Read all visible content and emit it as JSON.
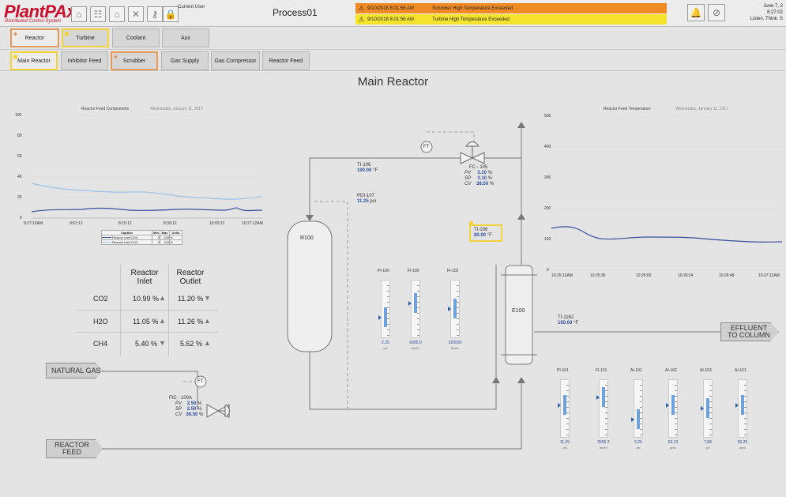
{
  "header": {
    "logo_main": "PlantPAx",
    "logo_sub": "Distributed Control System",
    "current_user_label": "Current User",
    "process_title": "Process01",
    "alarms": [
      {
        "timestamp": "9/10/2018 8:01:56 AM",
        "message": "Scrubber High Temperature Exceeded",
        "color": "#f08a24"
      },
      {
        "timestamp": "9/10/2018 8:01:56 AM",
        "message": "Turbine High Temperature Exceeded",
        "color": "#f5e32e"
      }
    ],
    "date": "June 7, 2",
    "time": "8:27:02",
    "tagline": "Listen. Think. S"
  },
  "nav_top": [
    "Reactor",
    "Turbine",
    "Coolant",
    "Aux"
  ],
  "nav_sub": [
    "Main Reactor",
    "Inhibitor Feed",
    "Scrubber",
    "Gas Supply",
    "Gas Compressor",
    "Reactor Feed"
  ],
  "page_title": "Main Reactor",
  "left_chart": {
    "title": "Reactor Feed Components",
    "date": "Wednesday, January 11, 2017",
    "y_ticks": [
      "100",
      "80",
      "60",
      "40",
      "20",
      "0"
    ],
    "x_ticks": [
      "9:27:12AM",
      "9:51:12",
      "",
      "8:15:12",
      "",
      "8:39:12",
      "",
      "10:03:12",
      "10:27:12AM"
    ],
    "legend_headers": [
      "Caption",
      "Min",
      "Max",
      "Units"
    ],
    "legend_rows": [
      [
        "Reactor Inlet CH4",
        "0",
        "100",
        "%"
      ],
      [
        "Reactor Inlet CO2",
        "0",
        "100",
        "%"
      ]
    ]
  },
  "right_chart": {
    "title": "Reactor Feed Temperature",
    "date": "Wednesday, January 11, 2017",
    "y_ticks": [
      "500",
      "400",
      "300",
      "200",
      "100",
      "0"
    ],
    "x_ticks": [
      "10:25:12AM",
      "10:25:36",
      "",
      "10:26:00",
      "",
      "10:26:24",
      "",
      "10:26:48",
      "",
      "10:27:12AM"
    ]
  },
  "composition": {
    "header_inlet": "Reactor Inlet",
    "header_outlet": "Reactor Outlet",
    "rows": [
      {
        "name": "CO2",
        "inlet": "10.99 %",
        "inlet_dir": "up",
        "outlet": "11.20 %",
        "outlet_dir": "down"
      },
      {
        "name": "H2O",
        "inlet": "11.05 %",
        "inlet_dir": "up",
        "outlet": "11.26 %",
        "outlet_dir": "up"
      },
      {
        "name": "CH4",
        "inlet": "5.40 %",
        "inlet_dir": "down",
        "outlet": "5.62 %",
        "outlet_dir": "up"
      }
    ]
  },
  "streams": {
    "natural_gas": "NATURAL GAS",
    "reactor_feed": "REACTOR FEED",
    "effluent": "EFFLUENT TO COLUMN"
  },
  "equipment": {
    "reactor": "R100",
    "exchanger": "E100"
  },
  "instruments": {
    "ti106a": {
      "tag": "TI-106",
      "value": "100.00",
      "unit": "°F"
    },
    "pdi107": {
      "tag": "PDI-107",
      "value": "11.25",
      "unit": "psi"
    },
    "fc105": {
      "tag": "FC - 105",
      "pv": "3.10",
      "sp": "3.10",
      "cv": "38.50",
      "unit": "%"
    },
    "ti106b": {
      "tag": "TI-106",
      "value": "80.00",
      "unit": "°F"
    },
    "ti1162": {
      "tag": "TI-1162",
      "value": "150.00",
      "unit": "°F"
    },
    "fic100a": {
      "tag": "FIC - 100A",
      "pv": "2.50",
      "sp": "2.50",
      "cv": "36.50",
      "unit": "%"
    },
    "ft": "FT",
    "pv_label": "PV",
    "sp_label": "SP",
    "cv_label": "CV"
  },
  "gauges_mid": [
    {
      "tag": "PI-100",
      "value": "2.25",
      "unit": "psi",
      "level": 0.35
    },
    {
      "tag": "FI-100",
      "value": "6000.0",
      "unit": "lbs/hr",
      "level": 0.6
    },
    {
      "tag": "FI-102",
      "value": "225000",
      "unit": "lbs/hr",
      "level": 0.5
    }
  ],
  "gauges_right": [
    {
      "tag": "PI-101",
      "value": "11.25",
      "unit": "psi",
      "level": 0.55
    },
    {
      "tag": "FI-101",
      "value": "2656.2",
      "unit": "lbs/hr",
      "level": 0.7
    },
    {
      "tag": "AI-101",
      "value": "5.25",
      "unit": "psi",
      "level": 0.3
    },
    {
      "tag": "AI-102",
      "value": "53.13",
      "unit": "ppm",
      "level": 0.55
    },
    {
      "tag": "AI-103",
      "value": "7.88",
      "unit": "pH",
      "level": 0.5
    },
    {
      "tag": "AI-101",
      "value": "56.25",
      "unit": "ppm",
      "level": 0.55
    }
  ],
  "colors": {
    "accent": "#c8102e",
    "value_blue": "#2f4fa0",
    "trend_dark": "#3a4f9a",
    "trend_light": "#9dc3e6"
  }
}
